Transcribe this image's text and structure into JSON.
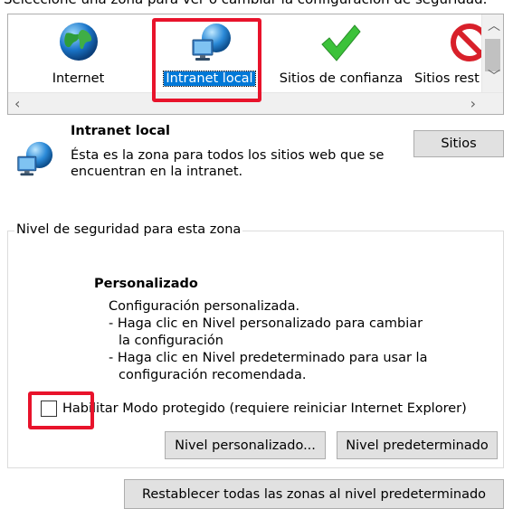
{
  "header": {
    "instruction": "Seleccione una zona para ver o cambiar la configuración de seguridad."
  },
  "zones": [
    {
      "label": "Internet",
      "icon": "globe-icon",
      "selected": false
    },
    {
      "label": "Intranet local",
      "icon": "intranet-globe-monitor-icon",
      "selected": true
    },
    {
      "label": "Sitios de confianza",
      "icon": "green-checkmark-icon",
      "selected": false
    },
    {
      "label": "Sitios rest",
      "icon": "restricted-sign-icon",
      "selected": false
    }
  ],
  "zone_info": {
    "title": "Intranet local",
    "description_line1": "Ésta es la zona para todos los sitios web que se",
    "description_line2": "encuentran en la intranet.",
    "sites_button": "Sitios"
  },
  "security_level": {
    "group_title": "Nivel de seguridad para esta zona",
    "level_title": "Personalizado",
    "line1": "Configuración personalizada.",
    "line2": "- Haga clic en Nivel personalizado para cambiar",
    "line3": "la configuración",
    "line4": "- Haga clic en Nivel predeterminado para usar la",
    "line5": "configuración recomendada.",
    "protected_mode_label": "Habilitar Modo protegido (requiere reiniciar Internet Explorer)",
    "protected_mode_checked": false,
    "custom_level_button": "Nivel personalizado...",
    "default_level_button": "Nivel predeterminado"
  },
  "reset_all_button": "Restablecer todas las zonas al nivel predeterminado",
  "colors": {
    "highlight": "#e8132b",
    "selection": "#0078d7"
  }
}
